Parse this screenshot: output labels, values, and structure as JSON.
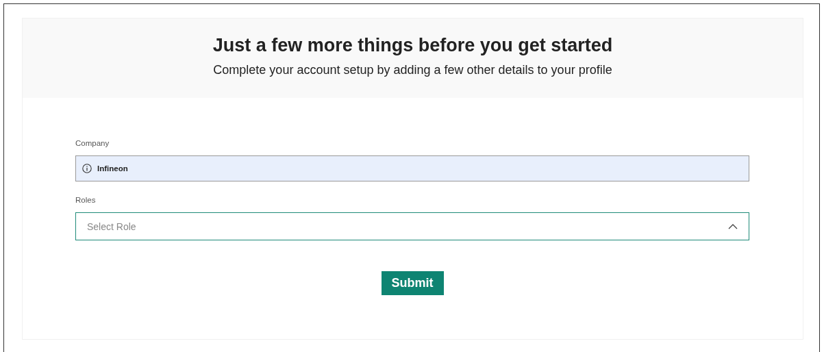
{
  "header": {
    "title": "Just a few more things before you get started",
    "subtitle": "Complete your account setup by adding a few other details to your profile"
  },
  "fields": [
    {
      "kind": "readonly",
      "label": "Company",
      "value": "Infineon"
    },
    {
      "kind": "select",
      "label": "Roles",
      "placeholder": "Select Role",
      "expanded": true
    }
  ],
  "submit": {
    "label": "Submit"
  }
}
